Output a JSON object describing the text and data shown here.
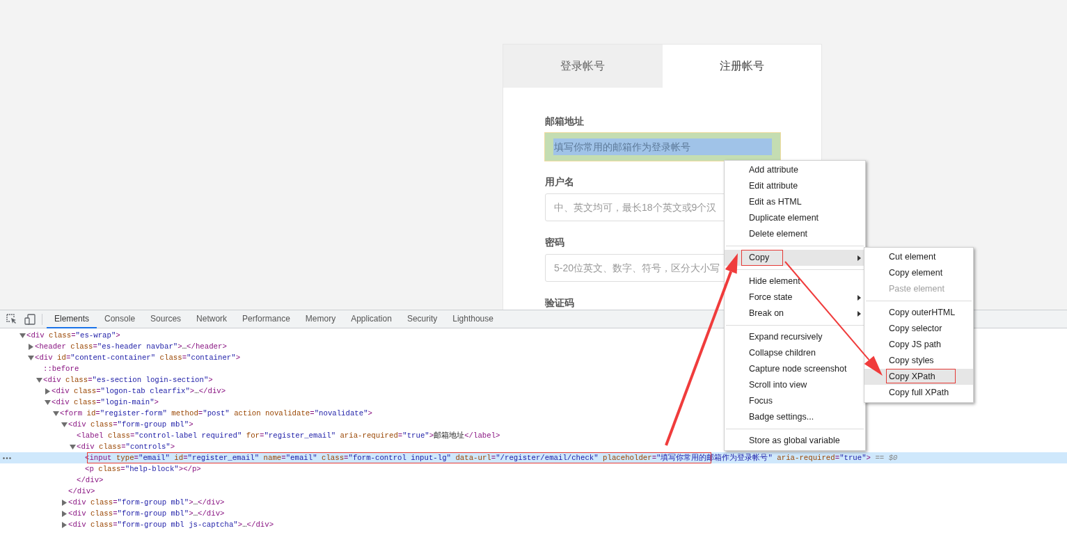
{
  "login_card": {
    "tabs": [
      {
        "label": "登录帐号",
        "selected": false
      },
      {
        "label": "注册帐号",
        "selected": true
      }
    ],
    "fields": [
      {
        "label": "邮箱地址",
        "placeholder": "填写你常用的邮箱作为登录帐号",
        "inspected": true
      },
      {
        "label": "用户名",
        "placeholder": "中、英文均可，最长18个英文或9个汉",
        "inspected": false
      },
      {
        "label": "密码",
        "placeholder": "5-20位英文、数字、符号，区分大小写",
        "inspected": false
      }
    ],
    "cut_label": "验证码"
  },
  "devtools": {
    "tabs": [
      {
        "label": "Elements",
        "selected": true
      },
      {
        "label": "Console",
        "selected": false
      },
      {
        "label": "Sources",
        "selected": false
      },
      {
        "label": "Network",
        "selected": false
      },
      {
        "label": "Performance",
        "selected": false
      },
      {
        "label": "Memory",
        "selected": false
      },
      {
        "label": "Application",
        "selected": false
      },
      {
        "label": "Security",
        "selected": false
      },
      {
        "label": "Lighthouse",
        "selected": false
      }
    ],
    "dom_tree": [
      {
        "kind": "expanded",
        "selected": false,
        "segments": [
          {
            "kind": "tag",
            "text": "<div "
          },
          {
            "kind": "attr",
            "text": "class"
          },
          {
            "kind": "tag",
            "text": "="
          },
          {
            "kind": "value",
            "text": "\"es-wrap\""
          },
          {
            "kind": "tag",
            "text": ">"
          }
        ],
        "children": [
          {
            "kind": "collapsed",
            "selected": false,
            "segments": [
              {
                "kind": "tag",
                "text": "<header "
              },
              {
                "kind": "attr",
                "text": "class"
              },
              {
                "kind": "tag",
                "text": "="
              },
              {
                "kind": "value",
                "text": "\"es-header navbar\""
              },
              {
                "kind": "tag",
                "text": ">"
              },
              {
                "kind": "text",
                "text": "…"
              },
              {
                "kind": "tag",
                "text": "</header>"
              }
            ]
          },
          {
            "kind": "expanded",
            "selected": false,
            "segments": [
              {
                "kind": "tag",
                "text": "<div "
              },
              {
                "kind": "attr",
                "text": "id"
              },
              {
                "kind": "tag",
                "text": "="
              },
              {
                "kind": "value",
                "text": "\"content-container\""
              },
              {
                "kind": "attr",
                "text": " class"
              },
              {
                "kind": "tag",
                "text": "="
              },
              {
                "kind": "value",
                "text": "\"container\""
              },
              {
                "kind": "tag",
                "text": ">"
              }
            ],
            "children": [
              {
                "kind": "leaf",
                "selected": false,
                "segments": [
                  {
                    "kind": "tag",
                    "text": "::before"
                  }
                ]
              },
              {
                "kind": "expanded",
                "selected": false,
                "segments": [
                  {
                    "kind": "tag",
                    "text": "<div "
                  },
                  {
                    "kind": "attr",
                    "text": "class"
                  },
                  {
                    "kind": "tag",
                    "text": "="
                  },
                  {
                    "kind": "value",
                    "text": "\"es-section login-section\""
                  },
                  {
                    "kind": "tag",
                    "text": ">"
                  }
                ],
                "children": [
                  {
                    "kind": "collapsed",
                    "selected": false,
                    "segments": [
                      {
                        "kind": "tag",
                        "text": "<div "
                      },
                      {
                        "kind": "attr",
                        "text": "class"
                      },
                      {
                        "kind": "tag",
                        "text": "="
                      },
                      {
                        "kind": "value",
                        "text": "\"logon-tab clearfix\""
                      },
                      {
                        "kind": "tag",
                        "text": ">"
                      },
                      {
                        "kind": "text",
                        "text": "…"
                      },
                      {
                        "kind": "tag",
                        "text": "</div>"
                      }
                    ]
                  },
                  {
                    "kind": "expanded",
                    "selected": false,
                    "segments": [
                      {
                        "kind": "tag",
                        "text": "<div "
                      },
                      {
                        "kind": "attr",
                        "text": "class"
                      },
                      {
                        "kind": "tag",
                        "text": "="
                      },
                      {
                        "kind": "value",
                        "text": "\"login-main\""
                      },
                      {
                        "kind": "tag",
                        "text": ">"
                      }
                    ],
                    "children": [
                      {
                        "kind": "expanded",
                        "selected": false,
                        "segments": [
                          {
                            "kind": "tag",
                            "text": "<form "
                          },
                          {
                            "kind": "attr",
                            "text": "id"
                          },
                          {
                            "kind": "tag",
                            "text": "="
                          },
                          {
                            "kind": "value",
                            "text": "\"register-form\""
                          },
                          {
                            "kind": "attr",
                            "text": " method"
                          },
                          {
                            "kind": "tag",
                            "text": "="
                          },
                          {
                            "kind": "value",
                            "text": "\"post\""
                          },
                          {
                            "kind": "attr",
                            "text": " action novalidate"
                          },
                          {
                            "kind": "tag",
                            "text": "="
                          },
                          {
                            "kind": "value",
                            "text": "\"novalidate\""
                          },
                          {
                            "kind": "tag",
                            "text": ">"
                          }
                        ],
                        "children": [
                          {
                            "kind": "expanded",
                            "selected": false,
                            "segments": [
                              {
                                "kind": "tag",
                                "text": "<div "
                              },
                              {
                                "kind": "attr",
                                "text": "class"
                              },
                              {
                                "kind": "tag",
                                "text": "="
                              },
                              {
                                "kind": "value",
                                "text": "\"form-group mbl\""
                              },
                              {
                                "kind": "tag",
                                "text": ">"
                              }
                            ],
                            "close": [
                              {
                                "kind": "tag",
                                "text": "</div>"
                              }
                            ],
                            "children": [
                              {
                                "kind": "leaf",
                                "selected": false,
                                "segments": [
                                  {
                                    "kind": "tag",
                                    "text": "<label "
                                  },
                                  {
                                    "kind": "attr",
                                    "text": "class"
                                  },
                                  {
                                    "kind": "tag",
                                    "text": "="
                                  },
                                  {
                                    "kind": "value",
                                    "text": "\"control-label required\""
                                  },
                                  {
                                    "kind": "attr",
                                    "text": " for"
                                  },
                                  {
                                    "kind": "tag",
                                    "text": "="
                                  },
                                  {
                                    "kind": "value",
                                    "text": "\"register_email\""
                                  },
                                  {
                                    "kind": "attr",
                                    "text": " aria-required"
                                  },
                                  {
                                    "kind": "tag",
                                    "text": "="
                                  },
                                  {
                                    "kind": "value",
                                    "text": "\"true\""
                                  },
                                  {
                                    "kind": "tag",
                                    "text": ">"
                                  },
                                  {
                                    "kind": "text",
                                    "text": "邮箱地址"
                                  },
                                  {
                                    "kind": "tag",
                                    "text": "</label>"
                                  }
                                ]
                              },
                              {
                                "kind": "expanded",
                                "selected": false,
                                "segments": [
                                  {
                                    "kind": "tag",
                                    "text": "<div "
                                  },
                                  {
                                    "kind": "attr",
                                    "text": "class"
                                  },
                                  {
                                    "kind": "tag",
                                    "text": "="
                                  },
                                  {
                                    "kind": "value",
                                    "text": "\"controls\""
                                  },
                                  {
                                    "kind": "tag",
                                    "text": ">"
                                  }
                                ],
                                "close": [
                                  {
                                    "kind": "tag",
                                    "text": "</div>"
                                  }
                                ],
                                "children": [
                                  {
                                    "kind": "leaf",
                                    "selected": true,
                                    "ref": "== $0",
                                    "segments": [
                                      {
                                        "kind": "tag",
                                        "text": "<input "
                                      },
                                      {
                                        "kind": "attr",
                                        "text": "type"
                                      },
                                      {
                                        "kind": "tag",
                                        "text": "="
                                      },
                                      {
                                        "kind": "value",
                                        "text": "\"email\""
                                      },
                                      {
                                        "kind": "attr",
                                        "text": " id"
                                      },
                                      {
                                        "kind": "tag",
                                        "text": "="
                                      },
                                      {
                                        "kind": "value",
                                        "text": "\"register_email\""
                                      },
                                      {
                                        "kind": "attr",
                                        "text": " name"
                                      },
                                      {
                                        "kind": "tag",
                                        "text": "="
                                      },
                                      {
                                        "kind": "value",
                                        "text": "\"email\""
                                      },
                                      {
                                        "kind": "attr",
                                        "text": " class"
                                      },
                                      {
                                        "kind": "tag",
                                        "text": "="
                                      },
                                      {
                                        "kind": "value",
                                        "text": "\"form-control input-lg\""
                                      },
                                      {
                                        "kind": "attr",
                                        "text": " data-url"
                                      },
                                      {
                                        "kind": "tag",
                                        "text": "="
                                      },
                                      {
                                        "kind": "value",
                                        "text": "\"/register/email/check\""
                                      },
                                      {
                                        "kind": "attr",
                                        "text": " placeholder"
                                      },
                                      {
                                        "kind": "tag",
                                        "text": "="
                                      },
                                      {
                                        "kind": "value",
                                        "text": "\"填写你常用的邮箱作为登录帐号\""
                                      },
                                      {
                                        "kind": "attr",
                                        "text": " aria-required"
                                      },
                                      {
                                        "kind": "tag",
                                        "text": "="
                                      },
                                      {
                                        "kind": "value",
                                        "text": "\"true\""
                                      },
                                      {
                                        "kind": "tag",
                                        "text": ">"
                                      }
                                    ]
                                  },
                                  {
                                    "kind": "leaf",
                                    "selected": false,
                                    "segments": [
                                      {
                                        "kind": "tag",
                                        "text": "<p "
                                      },
                                      {
                                        "kind": "attr",
                                        "text": "class"
                                      },
                                      {
                                        "kind": "tag",
                                        "text": "="
                                      },
                                      {
                                        "kind": "value",
                                        "text": "\"help-block\""
                                      },
                                      {
                                        "kind": "tag",
                                        "text": "></p>"
                                      }
                                    ]
                                  }
                                ]
                              }
                            ]
                          },
                          {
                            "kind": "collapsed",
                            "selected": false,
                            "segments": [
                              {
                                "kind": "tag",
                                "text": "<div "
                              },
                              {
                                "kind": "attr",
                                "text": "class"
                              },
                              {
                                "kind": "tag",
                                "text": "="
                              },
                              {
                                "kind": "value",
                                "text": "\"form-group mbl\""
                              },
                              {
                                "kind": "tag",
                                "text": ">"
                              },
                              {
                                "kind": "text",
                                "text": "…"
                              },
                              {
                                "kind": "tag",
                                "text": "</div>"
                              }
                            ]
                          },
                          {
                            "kind": "collapsed",
                            "selected": false,
                            "segments": [
                              {
                                "kind": "tag",
                                "text": "<div "
                              },
                              {
                                "kind": "attr",
                                "text": "class"
                              },
                              {
                                "kind": "tag",
                                "text": "="
                              },
                              {
                                "kind": "value",
                                "text": "\"form-group mbl\""
                              },
                              {
                                "kind": "tag",
                                "text": ">"
                              },
                              {
                                "kind": "text",
                                "text": "…"
                              },
                              {
                                "kind": "tag",
                                "text": "</div>"
                              }
                            ]
                          },
                          {
                            "kind": "collapsed",
                            "selected": false,
                            "segments": [
                              {
                                "kind": "tag",
                                "text": "<div "
                              },
                              {
                                "kind": "attr",
                                "text": "class"
                              },
                              {
                                "kind": "tag",
                                "text": "="
                              },
                              {
                                "kind": "value",
                                "text": "\"form-group mbl js-captcha\""
                              },
                              {
                                "kind": "tag",
                                "text": ">"
                              },
                              {
                                "kind": "text",
                                "text": "…"
                              },
                              {
                                "kind": "tag",
                                "text": "</div>"
                              }
                            ]
                          }
                        ]
                      }
                    ]
                  }
                ]
              }
            ]
          }
        ]
      }
    ]
  },
  "context_menu": [
    {
      "kind": "item",
      "label": "Add attribute",
      "selected": false,
      "submenu": false,
      "disabled": false
    },
    {
      "kind": "item",
      "label": "Edit attribute",
      "selected": false,
      "submenu": false,
      "disabled": false
    },
    {
      "kind": "item",
      "label": "Edit as HTML",
      "selected": false,
      "submenu": false,
      "disabled": false
    },
    {
      "kind": "item",
      "label": "Duplicate element",
      "selected": false,
      "submenu": false,
      "disabled": false
    },
    {
      "kind": "item",
      "label": "Delete element",
      "selected": false,
      "submenu": false,
      "disabled": false
    },
    {
      "kind": "separator"
    },
    {
      "kind": "item",
      "label": "Copy",
      "selected": true,
      "submenu": true,
      "disabled": false
    },
    {
      "kind": "separator"
    },
    {
      "kind": "item",
      "label": "Hide element",
      "selected": false,
      "submenu": false,
      "disabled": false
    },
    {
      "kind": "item",
      "label": "Force state",
      "selected": false,
      "submenu": true,
      "disabled": false
    },
    {
      "kind": "item",
      "label": "Break on",
      "selected": false,
      "submenu": true,
      "disabled": false
    },
    {
      "kind": "separator"
    },
    {
      "kind": "item",
      "label": "Expand recursively",
      "selected": false,
      "submenu": false,
      "disabled": false
    },
    {
      "kind": "item",
      "label": "Collapse children",
      "selected": false,
      "submenu": false,
      "disabled": false
    },
    {
      "kind": "item",
      "label": "Capture node screenshot",
      "selected": false,
      "submenu": false,
      "disabled": false
    },
    {
      "kind": "item",
      "label": "Scroll into view",
      "selected": false,
      "submenu": false,
      "disabled": false
    },
    {
      "kind": "item",
      "label": "Focus",
      "selected": false,
      "submenu": false,
      "disabled": false
    },
    {
      "kind": "item",
      "label": "Badge settings...",
      "selected": false,
      "submenu": false,
      "disabled": false
    },
    {
      "kind": "separator"
    },
    {
      "kind": "item",
      "label": "Store as global variable",
      "selected": false,
      "submenu": false,
      "disabled": false
    }
  ],
  "copy_submenu": [
    {
      "kind": "item",
      "label": "Cut element",
      "selected": false,
      "submenu": false,
      "disabled": false
    },
    {
      "kind": "item",
      "label": "Copy element",
      "selected": false,
      "submenu": false,
      "disabled": false
    },
    {
      "kind": "item",
      "label": "Paste element",
      "selected": false,
      "submenu": false,
      "disabled": true
    },
    {
      "kind": "separator"
    },
    {
      "kind": "item",
      "label": "Copy outerHTML",
      "selected": false,
      "submenu": false,
      "disabled": false
    },
    {
      "kind": "item",
      "label": "Copy selector",
      "selected": false,
      "submenu": false,
      "disabled": false
    },
    {
      "kind": "item",
      "label": "Copy JS path",
      "selected": false,
      "submenu": false,
      "disabled": false
    },
    {
      "kind": "item",
      "label": "Copy styles",
      "selected": false,
      "submenu": false,
      "disabled": false
    },
    {
      "kind": "item",
      "label": "Copy XPath",
      "selected": true,
      "submenu": false,
      "disabled": false
    },
    {
      "kind": "item",
      "label": "Copy full XPath",
      "selected": false,
      "submenu": false,
      "disabled": false
    }
  ]
}
